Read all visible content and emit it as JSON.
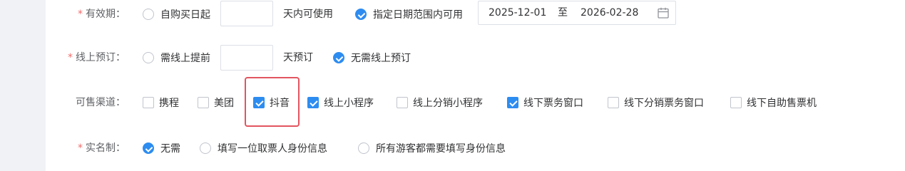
{
  "validity": {
    "label": "有效期：",
    "required_mark": "*",
    "option_from_purchase": "自购买日起",
    "days_suffix": "天内可使用",
    "option_date_range": "指定日期范围内可用",
    "start_date": "2025-12-01",
    "range_separator": "至",
    "end_date": "2026-02-28"
  },
  "online_booking": {
    "label": "线上预订：",
    "required_mark": "*",
    "option_advance": "需线上提前",
    "days_suffix": "天预订",
    "option_no_need": "无需线上预订"
  },
  "channels": {
    "label": "可售渠道：",
    "items": [
      {
        "label": "携程",
        "checked": false
      },
      {
        "label": "美团",
        "checked": false
      },
      {
        "label": "抖音",
        "checked": true
      },
      {
        "label": "线上小程序",
        "checked": true
      },
      {
        "label": "线上分销小程序",
        "checked": false
      },
      {
        "label": "线下票务窗口",
        "checked": true
      },
      {
        "label": "线下分销票务窗口",
        "checked": false
      },
      {
        "label": "线下自助售票机",
        "checked": false
      }
    ]
  },
  "real_name": {
    "label": "实名制：",
    "required_mark": "*",
    "options": [
      "无需",
      "填写一位取票人身份信息",
      "所有游客都需要填写身份信息"
    ]
  },
  "colors": {
    "accent": "#2d8cf0",
    "required": "#f56c6c",
    "highlight": "#e25560"
  }
}
